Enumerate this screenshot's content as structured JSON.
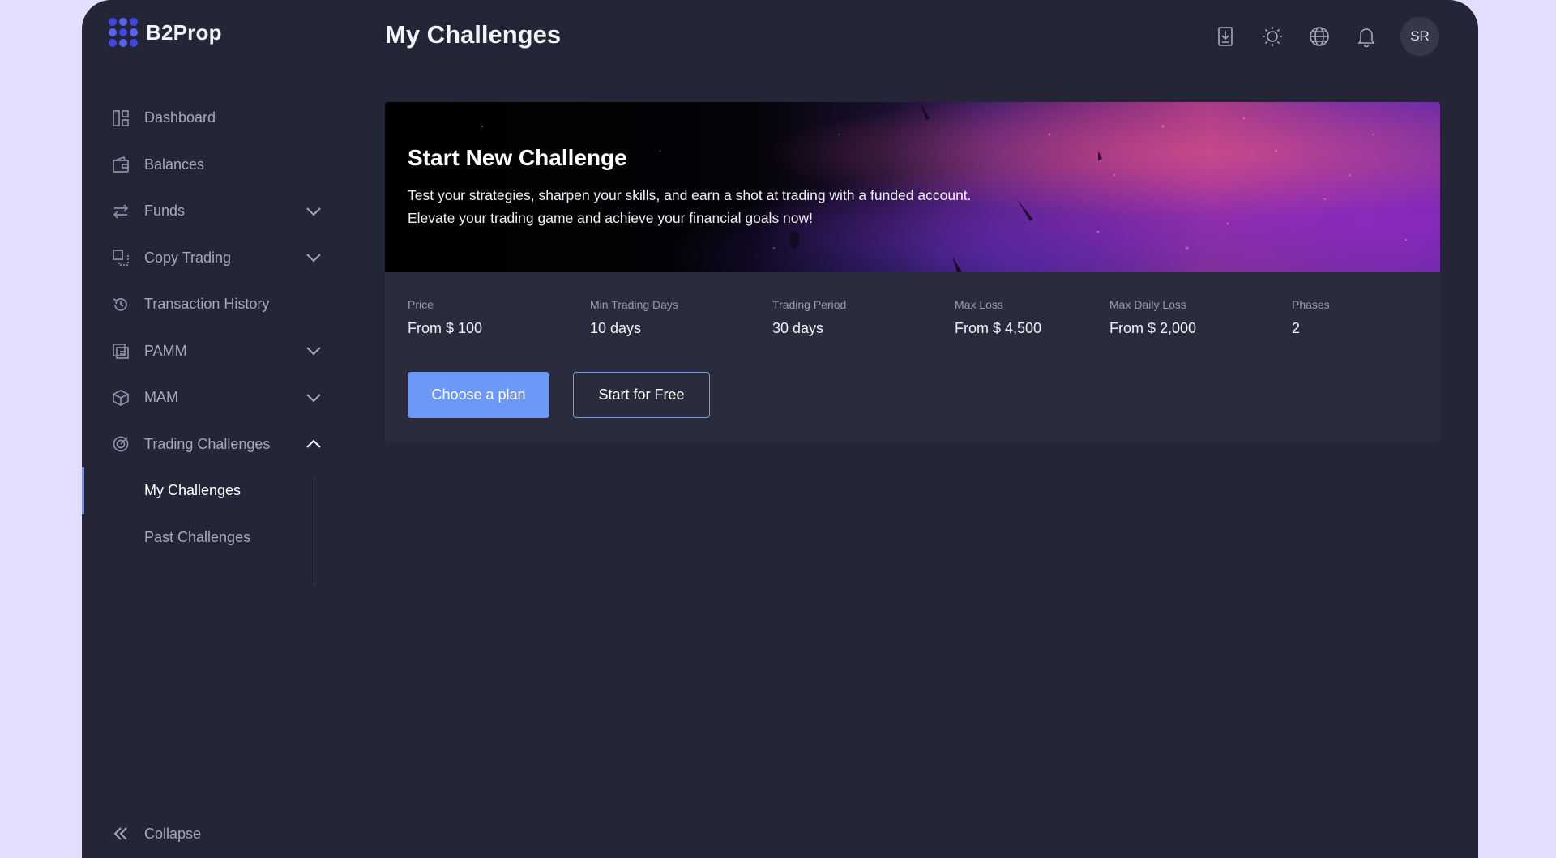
{
  "brand": {
    "name": "B2Prop"
  },
  "header": {
    "title": "My Challenges",
    "avatar_initials": "SR",
    "icons": [
      "download-icon",
      "sun-icon",
      "globe-icon",
      "bell-icon"
    ]
  },
  "sidebar": {
    "items": [
      {
        "label": "Dashboard",
        "icon": "dashboard-icon"
      },
      {
        "label": "Balances",
        "icon": "wallet-icon"
      },
      {
        "label": "Funds",
        "icon": "transfer-icon",
        "expandable": true
      },
      {
        "label": "Copy Trading",
        "icon": "copy-trading-icon",
        "expandable": true
      },
      {
        "label": "Transaction History",
        "icon": "history-icon"
      },
      {
        "label": "PAMM",
        "icon": "pamm-icon",
        "expandable": true
      },
      {
        "label": "MAM",
        "icon": "cube-icon",
        "expandable": true
      },
      {
        "label": "Trading Challenges",
        "icon": "target-icon",
        "expandable": true,
        "open": true
      }
    ],
    "sub_items": [
      {
        "label": "My Challenges",
        "active": true
      },
      {
        "label": "Past Challenges",
        "active": false
      }
    ],
    "collapse_label": "Collapse"
  },
  "challenge": {
    "title": "Start New Challenge",
    "description_line1": "Test your strategies, sharpen your skills, and earn a shot at trading with a funded account.",
    "description_line2": "Elevate your trading game and achieve your financial goals now!",
    "stats": [
      {
        "label": "Price",
        "value": "From $ 100"
      },
      {
        "label": "Min Trading Days",
        "value": "10 days"
      },
      {
        "label": "Trading Period",
        "value": "30 days"
      },
      {
        "label": "Max Loss",
        "value": "From $ 4,500"
      },
      {
        "label": "Max Daily Loss",
        "value": "From $ 2,000"
      },
      {
        "label": "Phases",
        "value": "2"
      }
    ],
    "primary_button": "Choose a plan",
    "secondary_button": "Start for Free"
  },
  "colors": {
    "accent": "#6c98f8",
    "panel": "#242637",
    "card": "#2a2c3d",
    "page_bg": "#e3defd"
  }
}
